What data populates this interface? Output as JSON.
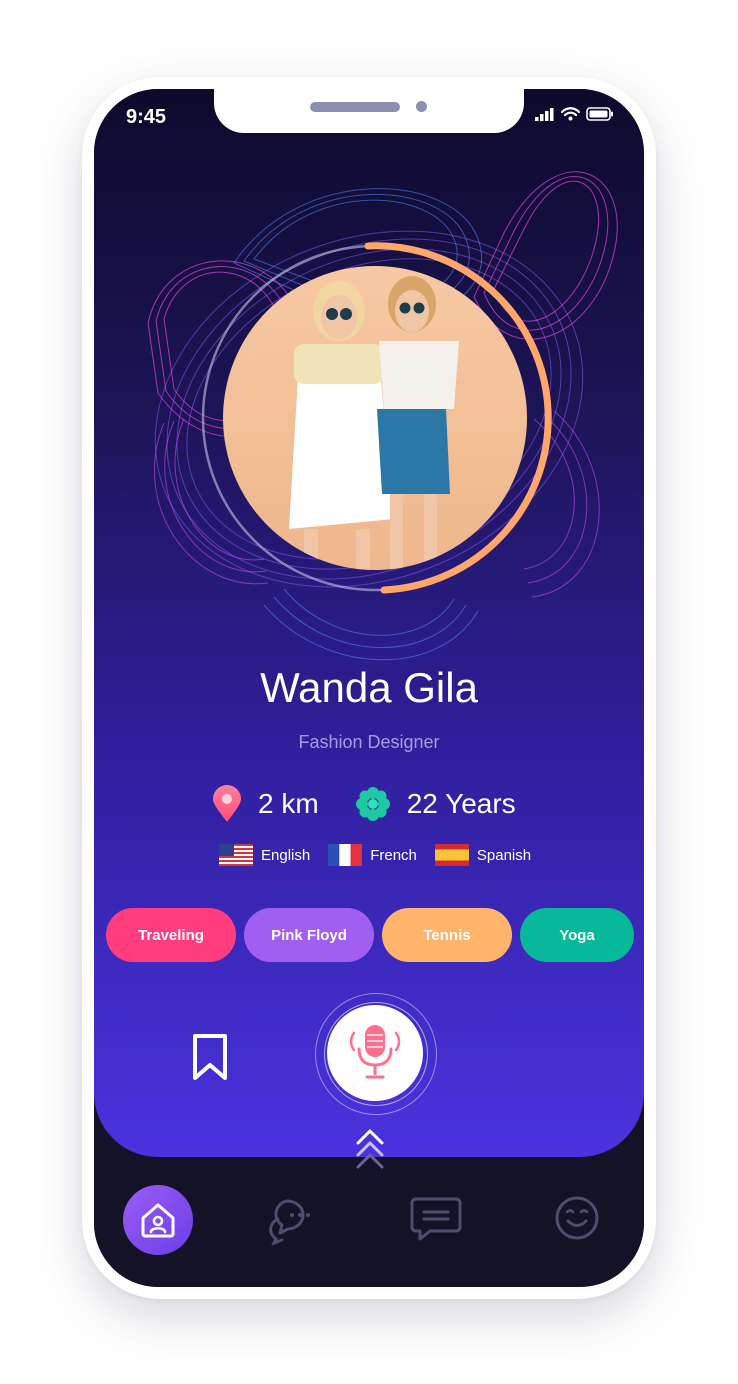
{
  "status_bar": {
    "time": "9:45"
  },
  "profile": {
    "name": "Wanda Gila",
    "occupation": "Fashion Designer",
    "distance": "2 km",
    "age": "22 Years",
    "languages": [
      {
        "label": "English",
        "flag": "us-flag"
      },
      {
        "label": "French",
        "flag": "france-flag"
      },
      {
        "label": "Spanish",
        "flag": "spain-flag"
      }
    ],
    "interests": [
      {
        "label": "Traveling",
        "color": "#ff3d7f"
      },
      {
        "label": "Pink Floyd",
        "color": "#a05ff0"
      },
      {
        "label": "Tennis",
        "color": "#ffb46b"
      },
      {
        "label": "Yoga",
        "color": "#08b89a"
      }
    ]
  },
  "actions": {
    "bookmark": "bookmark-icon",
    "voice": "microphone-icon",
    "expand": "double-chevron-up-icon"
  },
  "tabbar": {
    "items": [
      {
        "icon": "home-user-icon",
        "active": true
      },
      {
        "icon": "chat-bubbles-icon",
        "active": false
      },
      {
        "icon": "message-icon",
        "active": false
      },
      {
        "icon": "smiley-icon",
        "active": false
      }
    ]
  },
  "colors": {
    "gradient_top": "#0d0a2c",
    "gradient_bottom": "#4a33df",
    "progress_ring": "#ffa66b",
    "subtitle": "#a69ce3",
    "tab_active": "#8a4ff0"
  }
}
